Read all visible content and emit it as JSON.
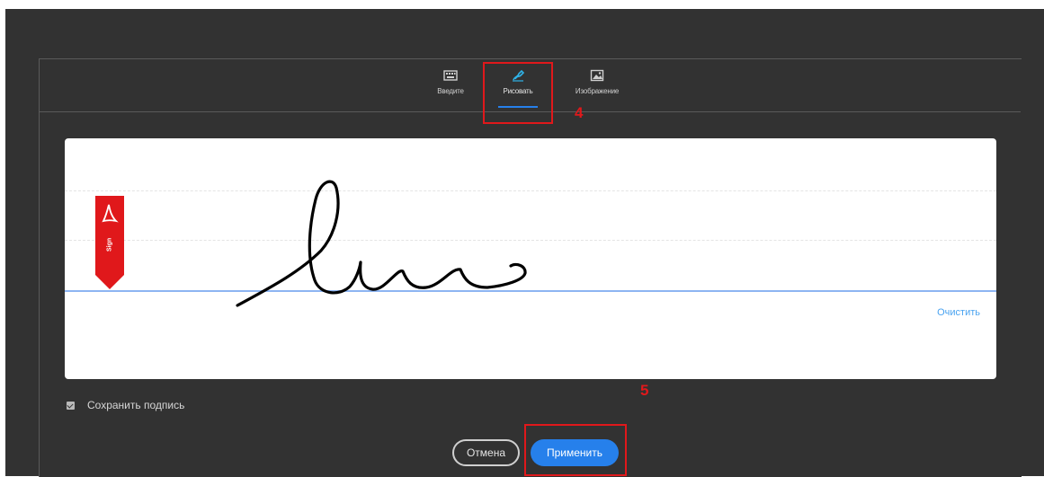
{
  "tabs": [
    {
      "label": "Введите",
      "icon": "keyboard-icon"
    },
    {
      "label": "Рисовать",
      "icon": "pen-draw-icon",
      "active": true
    },
    {
      "label": "Изображение",
      "icon": "image-icon"
    }
  ],
  "annotations": {
    "step_4": "4",
    "step_5": "5"
  },
  "canvas": {
    "flag_text": "Sign",
    "flag_icon": "adobe-acrobat-icon",
    "clear_label": "Очистить"
  },
  "save_signature": {
    "label": "Сохранить подпись",
    "checked": true
  },
  "buttons": {
    "cancel": "Отмена",
    "apply": "Применить"
  },
  "colors": {
    "background": "#323232",
    "accent": "#2680eb",
    "annotation": "#e0181b",
    "flag": "#e0181b"
  }
}
